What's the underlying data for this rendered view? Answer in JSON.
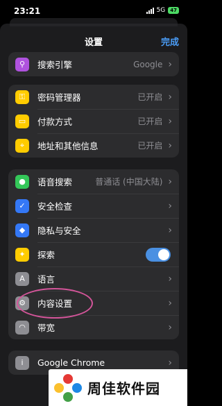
{
  "status_bar": {
    "time": "23:21",
    "network": "5G",
    "battery": "47"
  },
  "nav": {
    "title": "设置",
    "done_label": "完成"
  },
  "groups": [
    {
      "rows": [
        {
          "label": "搜索引擎",
          "value": "Google",
          "icon": "search-icon",
          "icon_color": "#af52de"
        }
      ]
    },
    {
      "rows": [
        {
          "label": "密码管理器",
          "value": "已开启",
          "icon": "key-icon",
          "icon_color": "#ffcc00"
        },
        {
          "label": "付款方式",
          "value": "已开启",
          "icon": "credit-card-icon",
          "icon_color": "#ffcc00"
        },
        {
          "label": "地址和其他信息",
          "value": "已开启",
          "icon": "location-pin-icon",
          "icon_color": "#ffcc00"
        }
      ]
    },
    {
      "rows": [
        {
          "label": "语音搜索",
          "value": "普通话 (中国大陆)",
          "icon": "microphone-icon",
          "icon_color": "#34c759"
        },
        {
          "label": "安全检查",
          "value": "",
          "icon": "shield-check-icon",
          "icon_color": "#3478f6"
        },
        {
          "label": "隐私与安全",
          "value": "",
          "icon": "shield-lock-icon",
          "icon_color": "#3478f6"
        },
        {
          "label": "探索",
          "value": "",
          "icon": "discover-icon",
          "icon_color": "#ffcc00",
          "toggle": true
        },
        {
          "label": "语言",
          "value": "",
          "icon": "translate-icon",
          "icon_color": "#8e8e93"
        },
        {
          "label": "内容设置",
          "value": "",
          "icon": "gear-icon",
          "icon_color": "#8e8e93"
        },
        {
          "label": "带宽",
          "value": "",
          "icon": "wifi-icon",
          "icon_color": "#8e8e93"
        }
      ]
    },
    {
      "rows": [
        {
          "label": "Google Chrome",
          "value": "",
          "icon": "info-icon",
          "icon_color": "#8e8e93"
        }
      ]
    }
  ],
  "watermark": {
    "text": "周佳软件园"
  }
}
